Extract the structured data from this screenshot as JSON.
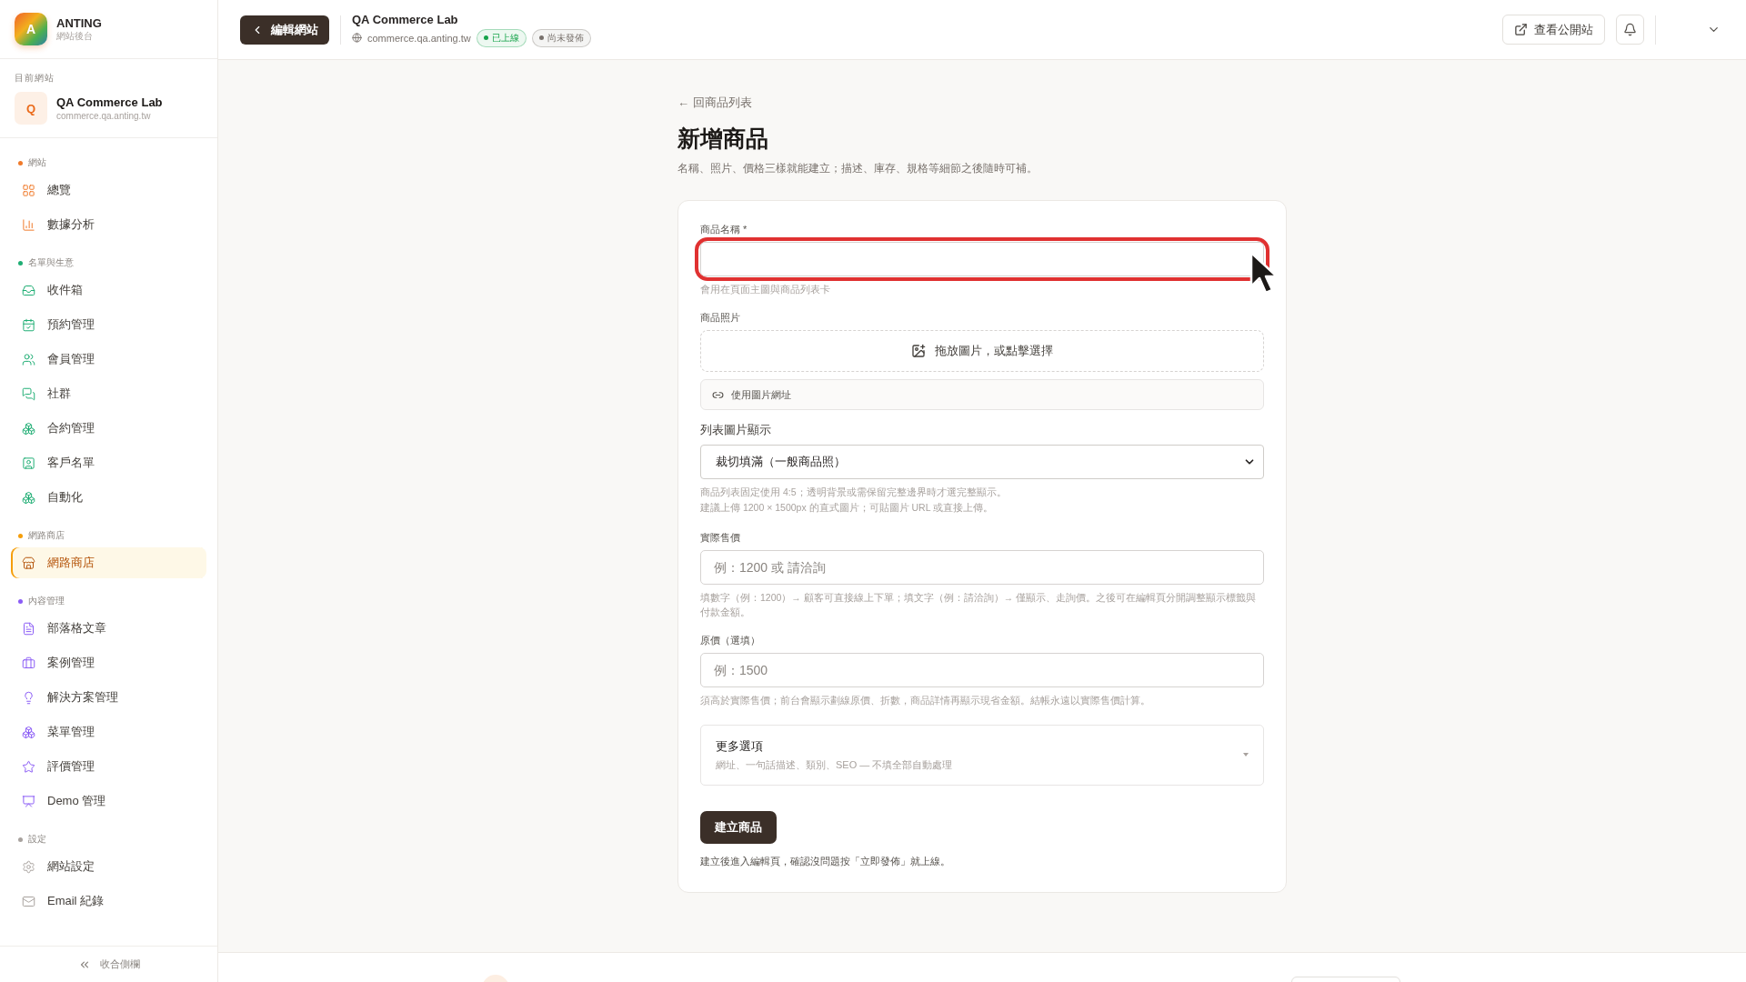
{
  "brand": {
    "logo_letter": "A",
    "name": "ANTING",
    "subtitle": "網站後台"
  },
  "current_site": {
    "label": "目前網站",
    "letter": "Q",
    "name": "QA Commerce Lab",
    "domain": "commerce.qa.anting.tw"
  },
  "sidebar": {
    "groups": [
      {
        "title": "網站",
        "color": "#f07a2a",
        "items": [
          {
            "label": "總覽",
            "selected": false
          },
          {
            "label": "數據分析",
            "selected": false
          }
        ]
      },
      {
        "title": "名單與生意",
        "color": "#1fae74",
        "items": [
          {
            "label": "收件箱",
            "selected": false
          },
          {
            "label": "預約管理",
            "selected": false
          },
          {
            "label": "會員管理",
            "selected": false
          },
          {
            "label": "社群",
            "selected": false
          },
          {
            "label": "合約管理",
            "selected": false
          },
          {
            "label": "客戶名單",
            "selected": false
          },
          {
            "label": "自動化",
            "selected": false
          }
        ]
      },
      {
        "title": "網路商店",
        "color": "#f59e0b",
        "items": [
          {
            "label": "網路商店",
            "selected": true
          }
        ]
      },
      {
        "title": "內容管理",
        "color": "#8b5cf6",
        "items": [
          {
            "label": "部落格文章",
            "selected": false
          },
          {
            "label": "案例管理",
            "selected": false
          },
          {
            "label": "解決方案管理",
            "selected": false
          },
          {
            "label": "菜單管理",
            "selected": false
          },
          {
            "label": "評價管理",
            "selected": false
          },
          {
            "label": "Demo 管理",
            "selected": false
          }
        ]
      },
      {
        "title": "設定",
        "color": "#a8a29e",
        "items": [
          {
            "label": "網站設定",
            "selected": false
          },
          {
            "label": "Email 紀錄",
            "selected": false
          }
        ]
      }
    ],
    "collapse": "收合側欄"
  },
  "header": {
    "back_button": "編輯網站",
    "site_name": "QA Commerce Lab",
    "domain": "commerce.qa.anting.tw",
    "badges": [
      {
        "label": "已上線",
        "color": "#16a34a"
      },
      {
        "label": "尚未發佈",
        "color": "#78716c"
      }
    ],
    "view_button": "查看公開站"
  },
  "page": {
    "back_link": "← 回商品列表",
    "title": "新增商品",
    "subtitle": "名稱、照片、價格三樣就能建立；描述、庫存、規格等細節之後隨時可補。"
  },
  "form": {
    "name": {
      "label": "商品名稱 *",
      "help": "會用在頁面主圖與商品列表卡",
      "highlighted": true
    },
    "photo": {
      "label": "商品照片",
      "dropzone": "拖放圖片，或點擊選擇",
      "url_button": "使用圖片網址"
    },
    "display": {
      "label": "列表圖片顯示",
      "value": "裁切填滿（一般商品照）",
      "help": [
        "商品列表固定使用 4:5；透明背景或需保留完整邊界時才選完整顯示。",
        "建議上傳 1200 × 1500px 的直式圖片；可貼圖片 URL 或直接上傳。"
      ]
    },
    "price": {
      "label": "實際售價",
      "placeholder": "例：1200 或 請洽詢",
      "help": "填數字（例：1200）→ 顧客可直接線上下單；填文字（例：請洽詢）→ 僅顯示、走詢價。之後可在編輯頁分開調整顯示標籤與付款金額。"
    },
    "original_price": {
      "label": "原價（選填）",
      "placeholder": "例：1500",
      "help": "須高於實際售價；前台會顯示劃線原價、折數，商品詳情再顯示現省金額。結帳永遠以實際售價計算。"
    },
    "more_options": {
      "title": "更多選項",
      "description": "網址、一句話描述、類別、SEO — 不填全部自動處理",
      "expanded": false
    },
    "submit": "建立商品",
    "note": "建立後進入編輯頁，確認沒問題按「立即發佈」就上線。"
  }
}
